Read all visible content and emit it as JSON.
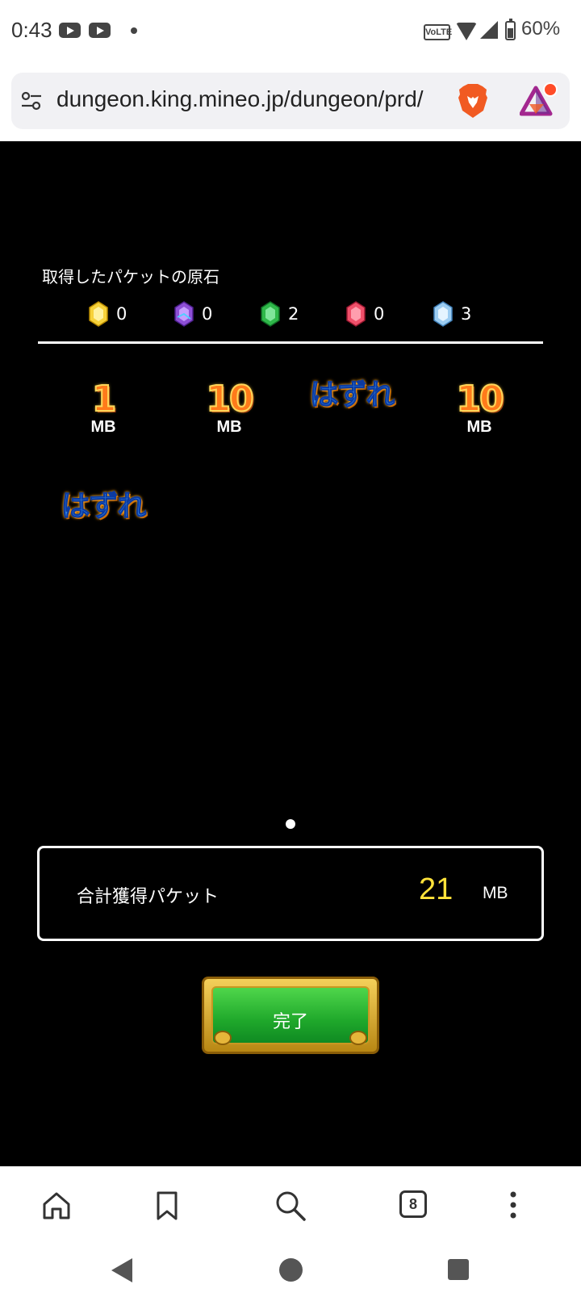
{
  "status_bar": {
    "time": "0:43",
    "volte": "VoLTE",
    "battery": "60%"
  },
  "browser": {
    "url": "dungeon.king.mineo.jp/dungeon/prd/",
    "tab_count": "8"
  },
  "game": {
    "gems_title": "取得したパケットの原石",
    "gems": [
      {
        "color": "yellow",
        "count": "0"
      },
      {
        "color": "purple",
        "count": "0"
      },
      {
        "color": "green",
        "count": "2"
      },
      {
        "color": "red",
        "count": "0"
      },
      {
        "color": "lightblue",
        "count": "3"
      }
    ],
    "prizes": [
      {
        "value": "1",
        "unit": "MB"
      },
      {
        "value": "10",
        "unit": "MB"
      },
      {
        "miss": "はずれ"
      },
      {
        "value": "10",
        "unit": "MB"
      },
      {
        "miss": "はずれ"
      }
    ],
    "total": {
      "label": "合計獲得パケット",
      "value": "21",
      "unit": "MB"
    },
    "done_button": "完了"
  },
  "colors": {
    "accent_total": "#ffe23a",
    "button_green": "#2ec13a",
    "frame_gold": "#d9a928"
  }
}
